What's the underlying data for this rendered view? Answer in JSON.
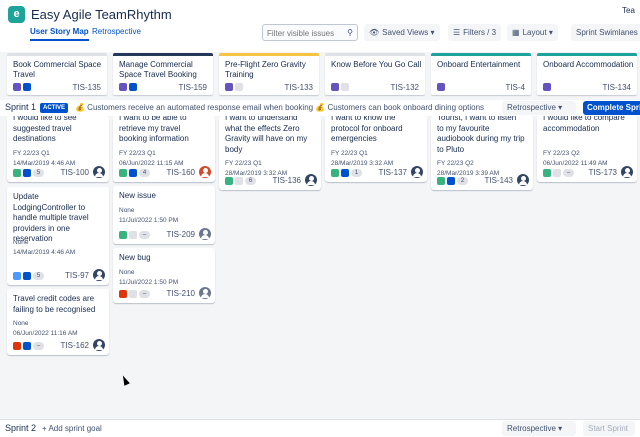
{
  "app": {
    "title": "Easy Agile TeamRhythm",
    "logo_letter": "e",
    "top_right": "Tea"
  },
  "tabs": [
    {
      "label": "User Story Map"
    },
    {
      "label": "Retrospective"
    }
  ],
  "toolbar": {
    "search_placeholder": "Filter visible issues",
    "saved_views": "Saved Views",
    "filters": "Filters / 3",
    "layout": "Layout",
    "swimlanes": "Sprint Swimlanes"
  },
  "columns": [
    {
      "title": "Book Commercial Space Travel",
      "key": "TIS-135",
      "color": "#dfe1e6",
      "badges": [
        "purple",
        "blue"
      ]
    },
    {
      "title": "Manage Commercial Space Travel Booking",
      "key": "TIS-159",
      "color": "#253858",
      "badges": [
        "purple",
        "blue"
      ]
    },
    {
      "title": "Pre-Flight Zero Gravity Training",
      "key": "TIS-133",
      "color": "#f6c342",
      "badges": [
        "purple",
        "gray"
      ]
    },
    {
      "title": "Know Before You Go Call",
      "key": "TIS-132",
      "color": "#dfe1e6",
      "badges": [
        "purple",
        "gray"
      ]
    },
    {
      "title": "Onboard Entertainment",
      "key": "TIS-4",
      "color": "#1ea39a",
      "badges": [
        "purple"
      ]
    },
    {
      "title": "Onboard Accommodation",
      "key": "TIS-134",
      "color": "#1ea39a",
      "badges": [
        "purple"
      ]
    }
  ],
  "sprint1": {
    "name": "Sprint 1",
    "status": "ACTIVE",
    "goal": "💰 Customers receive an automated response email when booking 💰 Customers can book onboard dining options",
    "retro_label": "Retrospective",
    "complete_label": "Complete Sprint"
  },
  "cards": [
    {
      "text": "I would like to see suggested travel destinations",
      "sprint": "FY 22/23 Q1",
      "date": "14/Mar/2019 4:46 AM",
      "key": "TIS-100",
      "count": "5",
      "badge": "green",
      "avatar": "dark"
    },
    {
      "text": "Update LodgingController to handle multiple travel providers in one reservation",
      "sprint": "None",
      "date": "14/Mar/2019 4:46 AM",
      "key": "TIS-97",
      "count": "5",
      "badge": "lightblue",
      "avatar": "dark"
    },
    {
      "text": "Travel credit codes are failing to be recognised",
      "sprint": "None",
      "date": "06/Jun/2022 11:16 AM",
      "key": "TIS-162",
      "count": "–",
      "badge": "red",
      "avatar": "dark"
    },
    {
      "text": "I want to be able to retrieve my travel booking information",
      "sprint": "FY 22/23 Q1",
      "date": "06/Jun/2022 11:15 AM",
      "key": "TIS-160",
      "count": "4",
      "badge": "green",
      "avatar": "orange"
    },
    {
      "text": "New issue",
      "sprint": "None",
      "date": "11/Jul/2022 1:50 PM",
      "key": "TIS-209",
      "count": "–",
      "badge": "green",
      "avatar": "gray"
    },
    {
      "text": "New bug",
      "sprint": "None",
      "date": "11/Jul/2022 1:50 PM",
      "key": "TIS-210",
      "count": "–",
      "badge": "red",
      "avatar": "gray"
    },
    {
      "text": "I want to understand what the effects Zero Gravity will have on my body",
      "sprint": "FY 22/23 Q1",
      "date": "28/Mar/2019 3:32 AM",
      "key": "TIS-136",
      "count": "6",
      "badge": "green",
      "avatar": "dark"
    },
    {
      "text": "I want to know the protocol for onboard emergencies",
      "sprint": "FY 22/23 Q1",
      "date": "28/Mar/2019 3:32 AM",
      "key": "TIS-137",
      "count": "1",
      "badge": "green",
      "avatar": "dark"
    },
    {
      "text": "Tourist, I want to listen to my favourite audiobook during my trip to Pluto",
      "sprint": "FY 22/23 Q2",
      "date": "28/Mar/2019 3:39 AM",
      "key": "TIS-143",
      "count": "2",
      "badge": "green",
      "avatar": "dark"
    },
    {
      "text": "I would like to compare accommodation",
      "sprint": "FY 22/23 Q2",
      "date": "06/Jun/2022 11:49 AM",
      "key": "TIS-173",
      "count": "–",
      "badge": "green",
      "avatar": "dark"
    }
  ],
  "sprint2": {
    "name": "Sprint 2",
    "add_goal": "+ Add sprint goal",
    "retro_label": "Retrospective",
    "start_label": "Start Sprint"
  }
}
